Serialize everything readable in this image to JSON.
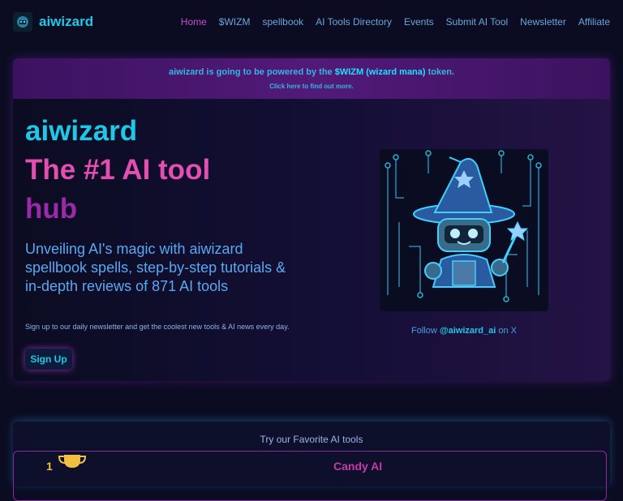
{
  "header": {
    "brand": "aiwizard",
    "nav": [
      {
        "label": "Home",
        "active": true
      },
      {
        "label": "$WIZM"
      },
      {
        "label": "spellbook"
      },
      {
        "label": "AI Tools Directory"
      },
      {
        "label": "Events"
      },
      {
        "label": "Submit AI Tool"
      },
      {
        "label": "Newsletter"
      },
      {
        "label": "Affiliate"
      }
    ]
  },
  "banner": {
    "prefix": "aiwizard is going to be powered by the ",
    "highlight": "$WIZM (wizard mana)",
    "suffix": " token.",
    "link": "Click here to find out more."
  },
  "hero": {
    "brand": "aiwizard",
    "title_line1": "The #1 AI tool",
    "title_line2": "hub",
    "subtitle": "Unveiling AI's magic with aiwizard spellbook spells, step-by-step tutorials & in-depth reviews of 871 AI tools",
    "signup_text": "Sign up to our daily newsletter and get the coolest new tools & AI news every day.",
    "signup_button": "Sign Up",
    "follow_prefix": "Follow ",
    "follow_handle": "@aiwizard_ai",
    "follow_suffix": " on X"
  },
  "favorites": {
    "title": "Try our Favorite AI tools",
    "first_rank": "1",
    "first_tool": "Candy AI"
  },
  "colors": {
    "accent_cyan": "#1ec8e6",
    "accent_pink": "#e24fb0",
    "accent_purple": "#9a2aa8",
    "background": "#0b0c22"
  }
}
